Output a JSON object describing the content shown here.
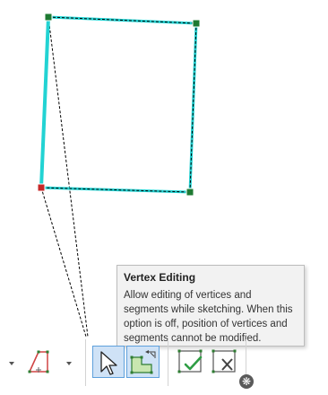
{
  "tooltip": {
    "title": "Vertex Editing",
    "lines": [
      "Allow editing of vertices and",
      "segments while sketching. When this",
      "option is off, position of vertices and",
      "segments cannot be modified."
    ]
  },
  "toolbar": {
    "buttons": [
      {
        "name": "previous-dropdown-arrow",
        "icon": "chevron-down-icon"
      },
      {
        "name": "trace-tool-button",
        "icon": "trace-polygon-icon"
      },
      {
        "name": "trace-dropdown-arrow",
        "icon": "chevron-down-icon"
      },
      {
        "name": "vertex-editing-button",
        "icon": "vertex-editing-icon",
        "state": "selected"
      },
      {
        "name": "sketch-constraints-button",
        "icon": "polygon-constraint-icon",
        "state": "selected"
      },
      {
        "name": "finish-sketch-button",
        "icon": "finish-check-icon"
      },
      {
        "name": "delete-sketch-button",
        "icon": "delete-x-icon"
      },
      {
        "name": "settings-button",
        "icon": "gear-icon"
      }
    ]
  },
  "colors": {
    "sketch_outline": "#22d3d3",
    "vertex_green": "#1e7a32",
    "vertex_red": "#c62828",
    "selected_fill": "#cfe2f6",
    "selected_border": "#5ea0dc",
    "tooltip_bg": "#f2f2f2"
  }
}
